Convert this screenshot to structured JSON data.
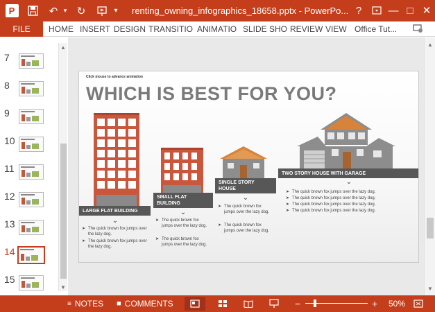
{
  "titlebar": {
    "title": "renting_owning_infographics_18658.pptx - PowerPo...",
    "app_icon_letter": "P",
    "icons": [
      "powerpoint-logo",
      "save-icon",
      "undo-icon",
      "redo-icon",
      "start-from-beginning-icon",
      "touch-mode-icon",
      "customize-qat-icon"
    ],
    "help": "?",
    "minimize": "—",
    "maximize": "□",
    "close": "✕"
  },
  "ribbon": {
    "file": "FILE",
    "tabs": [
      "HOME",
      "INSERT",
      "DESIGN",
      "TRANSITIO",
      "ANIMATIO",
      "SLIDE SHO",
      "REVIEW",
      "VIEW",
      "Office Tut..."
    ]
  },
  "slides_pane": {
    "numbers": [
      "7",
      "8",
      "9",
      "10",
      "11",
      "12",
      "13",
      "14",
      "15"
    ],
    "active": "14"
  },
  "slide": {
    "hint": "Click mouse to advance animation",
    "title": "WHICH IS BEST FOR YOU?",
    "sections": [
      {
        "label": "LARGE FLAT BUILDING",
        "bullets": [
          "The quick brown fox jumps over the lazy dog.",
          "The quick brown fox jumps over the lazy dog."
        ]
      },
      {
        "label": "SMALL FLAT BUILDING",
        "label_lines": [
          "SMALL FLAT",
          "BUILDING"
        ],
        "bullets": [
          "The quick brown fox jumps over the lazy dog.",
          "The quick brown fox jumps over the lazy dog."
        ]
      },
      {
        "label": "SINGLE STORY HOUSE",
        "label_lines": [
          "SINGLE STORY",
          "HOUSE"
        ],
        "bullets": [
          "The quick brown fox jumps over the lazy dog.",
          "The quick brown fox jumps over the lazy dog."
        ]
      },
      {
        "label": "TWO STORY HOUSE WITH GARAGE",
        "bullets": [
          "The quick brown fox jumps over the lazy dog.",
          "The quick brown fox jumps over the lazy dog.",
          "The quick brown fox jumps over the lazy dog.",
          "The quick brown fox jumps over the lazy dog."
        ]
      }
    ],
    "colors": {
      "brick": "#c8573e",
      "window": "#ffffff",
      "roof": "#d8833a",
      "wall_gray": "#8d8d8d",
      "label_bg": "#575757"
    }
  },
  "statusbar": {
    "notes": "NOTES",
    "comments": "COMMENTS",
    "zoom": "50%",
    "zoom_out": "−",
    "zoom_in": "+",
    "view_icons": [
      "normal-view-icon",
      "slide-sorter-icon",
      "reading-view-icon",
      "slide-show-icon"
    ]
  },
  "theme": {
    "accent": "#c43e1c"
  }
}
